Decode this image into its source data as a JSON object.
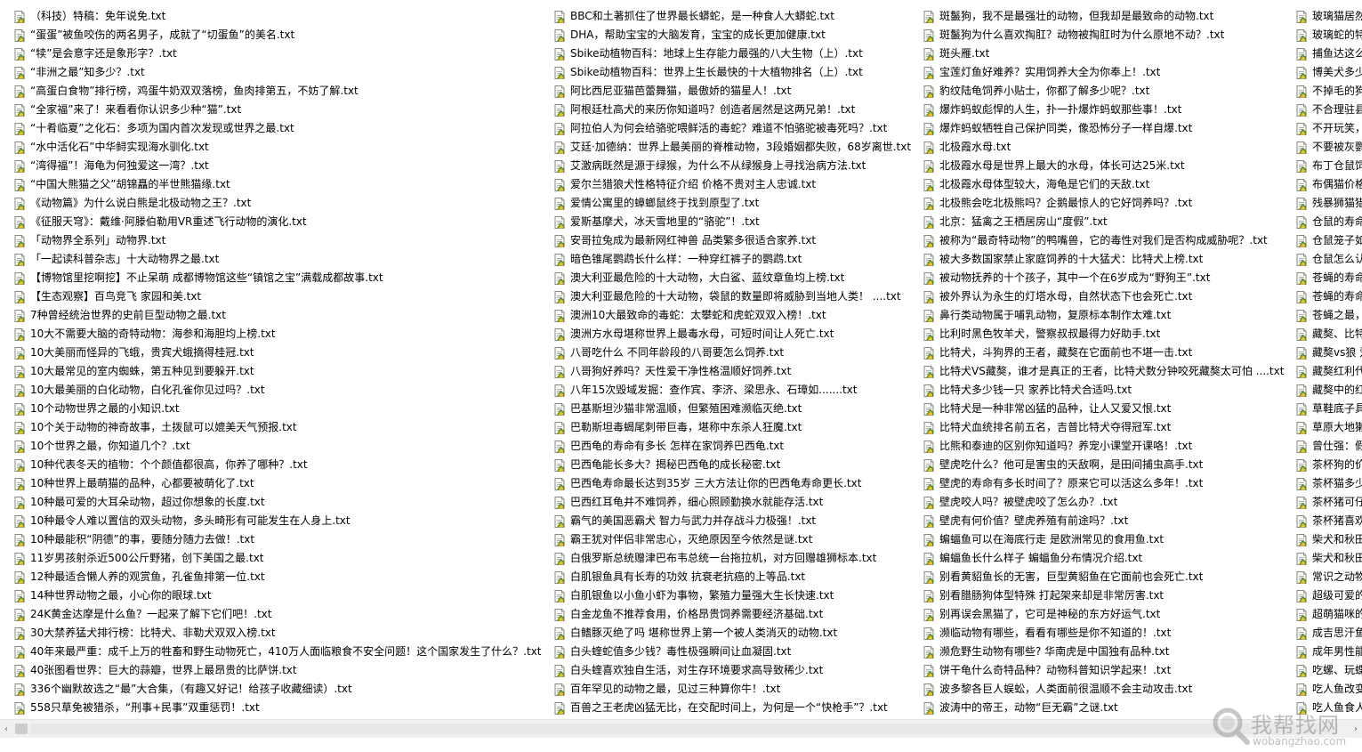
{
  "columns": [
    {
      "files": [
        "（科技）特稿：免年说免.txt",
        "“蛋蛋”被鱼咬伤的两名男子，成就了“切蛋鱼”的美名.txt",
        "“犊”是会意字还是象形字？.txt",
        "“非洲之最”知多少？.txt",
        "“高蛋白食物”排行榜，鸡蛋牛奶双双落榜，鱼肉排第五，不妨了解.txt",
        "“全家福”来了！来看看你认识多少种“猫”.txt",
        "“十肴临夏”之化石：多项为国内首次发现或世界之最.txt",
        "“水中活化石”中华鲟实现海水驯化.txt",
        "“湾得福”！海龟为何独爱这一湾？.txt",
        "“中国大熊猫之父”胡锦矗的半世熊猫缘.txt",
        "《动物篇》为什么说白熊是北极动物之王？.txt",
        "《征服天穹》：戴维·阿滕伯勒用VR重述飞行动物的演化.txt",
        "「动物界全系列」动物界.txt",
        "「一起读科普杂志」十大动物界之最.txt",
        "【博物馆里挖啊挖】不止呆萌 成都博物馆这些“镇馆之宝”满载成都故事.txt",
        "【生态观察】百鸟竞飞 家园和美.txt",
        "7种曾经统治世界的史前巨型动物之最.txt",
        "10大不需要大脑的奇特动物：海参和海胆均上榜.txt",
        "10大美丽而怪异的飞蛾，贵宾犬蛾摘得桂冠.txt",
        "10大最常见的室内蜘蛛，第五种见到要躲开.txt",
        "10大最美丽的白化动物，白化孔雀你见过吗？.txt",
        "10个动物世界之最的小知识.txt",
        "10个关于动物的神奇故事，土拨鼠可以媲美天气预报.txt",
        "10个世界之最，你知道几个？.txt",
        "10种代表冬天的植物：个个颜值都很高，你养了哪种？.txt",
        "10种世界上最萌猫的品种，心都要被萌化了.txt",
        "10种最可爱的大耳朵动物，超过你想象的长度.txt",
        "10种最令人难以置信的双头动物，多头畸形有可能发生在人身上.txt",
        "10种最能积“阴德”的事，要随分随力去做！.txt",
        "11岁男孩射杀近500公斤野猪，创下美国之最.txt",
        "12种最适合懒人养的观赏鱼，孔雀鱼排第一位.txt",
        "14种世界动物之最，小心你的眼球.txt",
        "24K黄金达摩是什么鱼？一起来了解下它们吧！.txt",
        "30大禁养猛犬排行榜：比特犬、非勒犬双双入榜.txt",
        "40年来最严重：成千上万的牲畜和野生动物死亡，410万人面临粮食不安全问题！这个国家发生了什么？.txt",
        "40张图看世界：巨大的蒜瓣，世界上最昂贵的比萨饼.txt",
        "336个幽默故选之“最”大合集，（有趣又好记！给孩子收藏细读）.txt",
        "558只草免被猎杀，“刑事+民事”双重惩罚！.txt"
      ]
    },
    {
      "files": [
        "BBC和土著抓住了世界最长蟒蛇，是一种食人大蟒蛇.txt",
        "DHA，帮助宝宝的大脑发育，宝宝的成长更加健康.txt",
        "Sbike动植物百科：地球上生存能力最强的八大生物（上）.txt",
        "Sbike动植物百科：世界上生长最快的十大植物排名（上）.txt",
        "阿比西尼亚猫芭蕾舞猫，最傲娇的猫星人！.txt",
        "阿根廷杜高犬的来历你知道吗？创造者居然是这两兄弟！.txt",
        "阿拉伯人为何会给骆驼喂鲜活的毒蛇？难道不怕骆驼被毒死吗？.txt",
        "艾廷·加德纳：世界上最美丽的脊椎动物，3段婚姻都失败，68岁离世.txt",
        "艾激病既然是源于绿猴，为什么不从绿猴身上寻找治病方法.txt",
        "爱尔兰猎狼犬性格特征介绍 价格不贵对主人忠诚.txt",
        "爱情公寓里的蟑螂鼠终于找到原型了.txt",
        "爱斯基摩犬，冰天雪地里的“骆驼”！.txt",
        "安哥拉兔成为最新网红神兽 品类繁多很适合家养.txt",
        "暗色锥尾鹦鹉长什么样：一种穿红裤子的鹦鹉.txt",
        "澳大利亚最危险的十大动物，大白鲨、蓝纹章鱼均上榜.txt",
        "澳大利亚最危险的十大动物，袋鼠的数量即将威胁到当地人类！ ....txt",
        "澳洲10大最致命的毒蛇：太攀蛇和虎蛇双双入榜！.txt",
        "澳洲方水母堪称世界上最毒水母，可短时间让人死亡.txt",
        "八哥吃什么 不同年龄段的八哥要怎么饲养.txt",
        "八哥狗好养吗？天性爱干净性格温顺好饲养.txt",
        "八年15次毁域发掘：查作宾、李济、梁思永、石璋如.......txt",
        "巴基斯坦沙猫非常温顺，但繁殖困难濒临灭绝.txt",
        "巴勒斯坦毒蝎尾刺带巨毒，堪称中东杀人狂魔.txt",
        "巴西龟的寿命有多长 怎样在家饲养巴西龟.txt",
        "巴西龟能长多大？揭秘巴西龟的成长秘密.txt",
        "巴西龟寿命最长达到35岁 三大方法让你的巴西龟寿命更长.txt",
        "巴西红耳龟并不难饲养，细心照顾勤换水就能存活.txt",
        "霸气的美国恶霸犬 智力与武力并存战斗力极强！.txt",
        "霸王犹对伴侣非常忠心，灭绝原因至今依然是谜.txt",
        "白俄罗斯总统赠津巴布韦总统一台拖拉机，对方回赠雄狮标本.txt",
        "白肌银鱼具有长寿的功效 抗衰老抗癌的上等品.txt",
        "白肌银鱼以小鱼小虾为事物，繁殖力量强大生长快速.txt",
        "白金龙鱼不推荐食用，价格昂贵饲养需要经济基础.txt",
        "白鳍豚灭绝了吗 堪称世界上第一个被人类消灭的动物.txt",
        "白头蝰蛇值多少钱？毒性极强瞬间让血凝固.txt",
        "白头蝰喜欢独自生活，对生存环境要求高导致稀少.txt",
        "百年罕见的动物之最，见过三种算你牛！.txt",
        "百兽之王老虎凶猛无比，在交配时间上，为何是一个“快枪手”？.txt"
      ]
    },
    {
      "files": [
        "斑鬣狗，我不是最强壮的动物，但我却是最致命的动物.txt",
        "斑鬣狗为什么喜欢掏肛？动物被掏肛时为什么原地不动？.txt",
        "斑头雁.txt",
        "宝莲灯鱼好难养？实用饲养大全为你奉上！.txt",
        "豹纹陆龟饲养小贴士，你都了解多少呢？.txt",
        "爆炸蚂蚁彪悍的人生，扑一扑爆炸蚂蚁那些事！.txt",
        "爆炸蚂蚁牺牲自己保护同类，像恐怖分子一样自爆.txt",
        "北极霞水母.txt",
        "北极霞水母是世界上最大的水母，体长可达25米.txt",
        "北极霞水母体型较大，海龟是它们的天敌.txt",
        "北极熊会吃北极熊吗？企鹅最惊人的它好饲养吗？.txt",
        "北京：猛禽之王栖居房山“度假”.txt",
        "被称为“最奇特动物”的鸭嘴兽，它的毒性对我们是否构成威胁呢？.txt",
        "被大多数国家禁止家庭饲养的十大猛犬：比特犬上榜.txt",
        "被动物抚养的十个孩子，其中一个在6岁成为“野狗王”.txt",
        "被外界认为永生的灯塔水母，自然状态下也会死亡.txt",
        "鼻行类动物属于哺乳动物，复原标本制作太难.txt",
        "比利时黑色牧羊犬，警察叔叔最得力好助手.txt",
        "比特犬，斗狗界的王者，藏獒在它面前也不堪一击.txt",
        "比特犬VS藏獒，谁才是真正的王者，比特犬数分钟咬死藏獒太可怕 ....txt",
        "比特犬多少钱一只 家养比特犬合适吗.txt",
        "比特犬是一种非常凶猛的品种，让人又爱又恨.txt",
        "比特犬血统排名前五名，吉普比特犬夺得冠军.txt",
        "比熊和泰迪的区别你知道吗？养宠小课堂开课咯！.txt",
        "壁虎吃什么？他可是害虫的天敌啊，是田间捕虫高手.txt",
        "壁虎的寿命有多长时间了？原来它可以活这么多年！.txt",
        "壁虎咬人吗？被壁虎咬了怎么办？.txt",
        "壁虎有何价值？壁虎养殖有前途吗？.txt",
        "蝙蝠鱼可以在海底行走 是欧洲常见的食用鱼.txt",
        "蝙蝠鱼长什么样子 蝙蝠鱼分布情况介绍.txt",
        "别看黄貂鱼长的无害，巨型黄貂鱼在它面前也会死亡.txt",
        "别看腊肠狗体型特殊 打起架来却是非常厉害.txt",
        "别再误会黑猫了，它可是神秘的东方好运气.txt",
        "濒临动物有哪些，看看有哪些是你不知道的！.txt",
        "濒危野生动物有哪些? 华南虎是中国独有品种.txt",
        "饼干龟什么奇特品种？动物科普知识学起来！.txt",
        "波多黎各巨人蜈蚣，人类面前很温顺不会主动攻击.txt",
        "波涛中的帝王，动物“巨无霸”之谜.txt"
      ]
    },
    {
      "files": [
        "玻璃猫居然",
        "玻璃蛇的特",
        "捕鱼达这么",
        "博美犬多少",
        "不掉毛的狗",
        "不合理驻县",
        "不开玩笑，",
        "不要被灰鹦",
        "布丁仓鼠饲",
        "布偶猫价格",
        "残暴狮猫猎",
        "仓鼠的寿命",
        "仓鼠笼子如",
        "仓鼠怎么认",
        "苍蝇的寿命",
        "苍蝇的寿命",
        "苍蝇之最，",
        "藏獒、比特",
        "藏獒vs狼 爱",
        "藏獒红利代",
        "藏獒中的红",
        "草鞋底子具",
        "草原大地獭",
        "曾仕强：假",
        "茶杯狗的价",
        "茶杯猫多少",
        "茶杯猪可仔",
        "茶杯猪喜欢",
        "柴犬和秋田",
        "柴犬和秋田",
        "常识之动物",
        "超级可爱的",
        "超萌猫咪的",
        "成吉思汗鱼",
        "成年男性能",
        "吃螺、玩蝶",
        "吃人鱼改变",
        "吃人鱼食人"
      ]
    }
  ],
  "scrollbar": {
    "left_arrow": "‹",
    "right_arrow": "›"
  },
  "watermark": {
    "title": "我帮找网",
    "url": "wobangzhao.com"
  }
}
